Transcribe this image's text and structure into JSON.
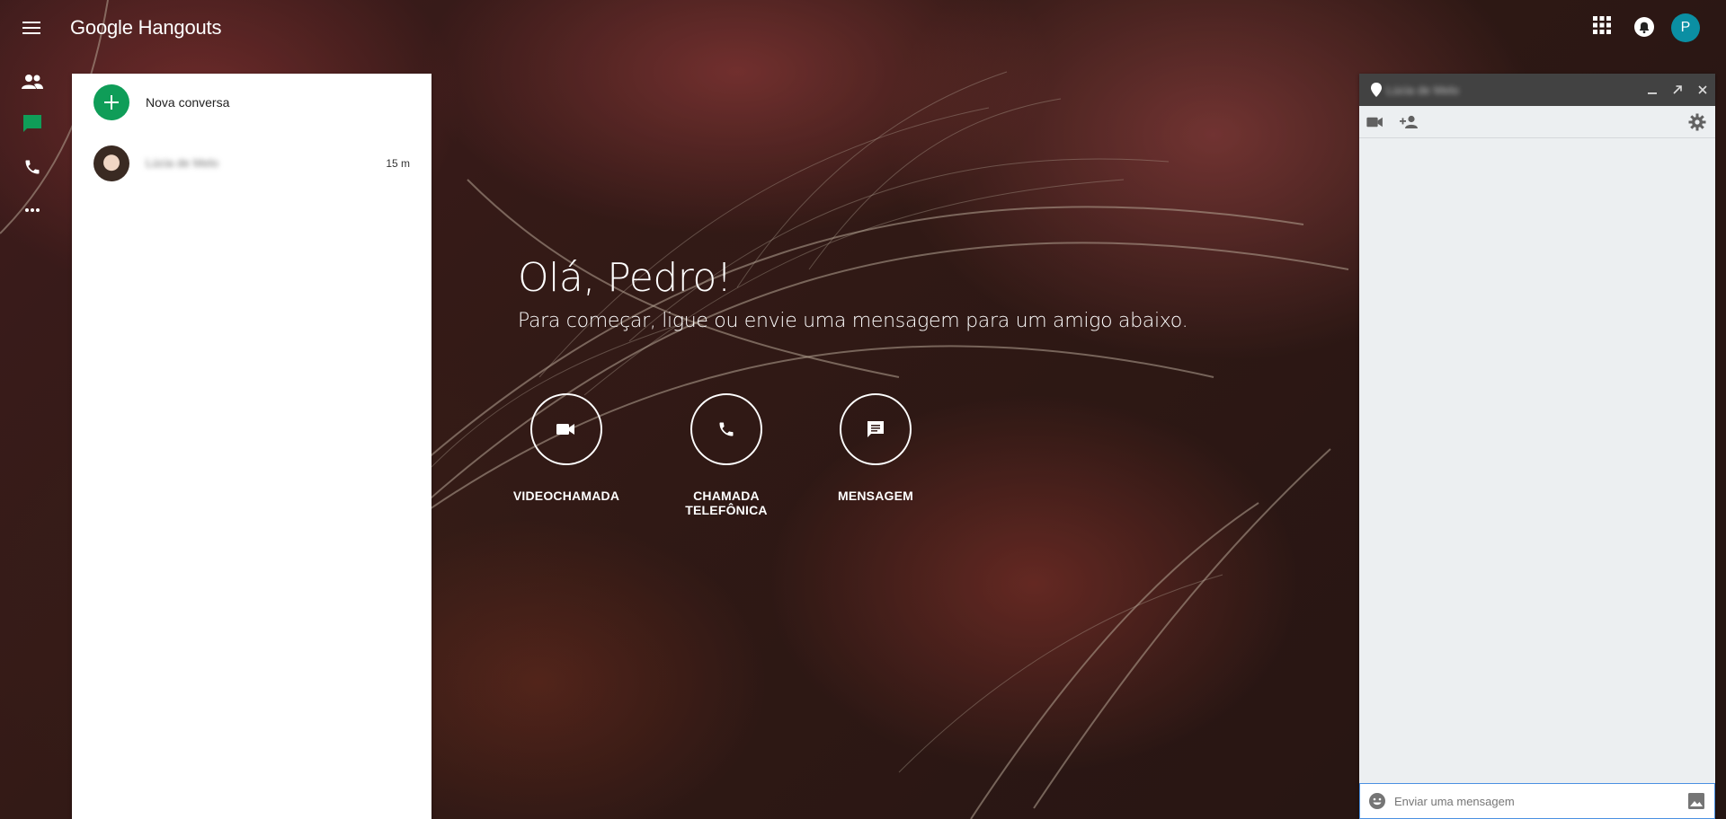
{
  "app": {
    "brand_google": "Google",
    "brand_product": "Hangouts"
  },
  "account": {
    "avatar_initial": "P",
    "avatar_color": "#0b8fa3"
  },
  "rail": {
    "items": [
      {
        "icon": "contacts-icon"
      },
      {
        "icon": "chat-icon",
        "active": true,
        "color": "#0f9d58"
      },
      {
        "icon": "phone-icon"
      },
      {
        "icon": "more-icon"
      }
    ]
  },
  "conversations": {
    "new_label": "Nova conversa",
    "items": [
      {
        "name": "Lúcia de Melo",
        "time": "15 m"
      }
    ]
  },
  "welcome": {
    "greeting": "Olá, Pedro!",
    "subtitle": "Para começar, ligue ou envie uma mensagem para um amigo abaixo.",
    "actions": [
      {
        "label": "VIDEOCHAMADA",
        "icon": "video-icon"
      },
      {
        "label": "CHAMADA TELEFÔNICA",
        "icon": "phone-icon"
      },
      {
        "label": "MENSAGEM",
        "icon": "message-icon"
      }
    ]
  },
  "chat": {
    "title": "Lúcia de Melo",
    "input_placeholder": "Enviar uma mensagem"
  }
}
